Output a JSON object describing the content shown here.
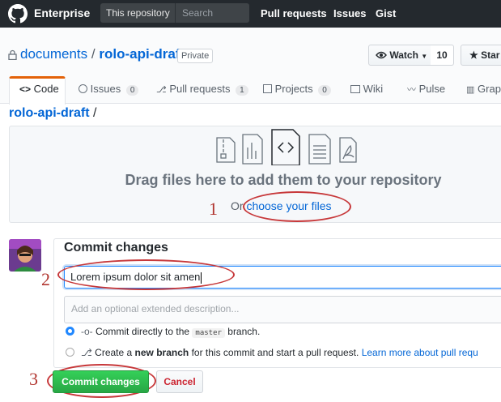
{
  "header": {
    "brand": "Enterprise",
    "scope_label": "This repository",
    "search_placeholder": "Search",
    "nav": [
      "Pull requests",
      "Issues",
      "Gist"
    ]
  },
  "repo": {
    "owner": "documents",
    "separator": "/",
    "name": "rolo-api-draft",
    "visibility": "Private",
    "watch_label": "Watch",
    "watch_count": "10",
    "star_label": "Star"
  },
  "tabs": [
    {
      "label": "Code",
      "count": null,
      "selected": true
    },
    {
      "label": "Issues",
      "count": "0"
    },
    {
      "label": "Pull requests",
      "count": "1"
    },
    {
      "label": "Projects",
      "count": "0"
    },
    {
      "label": "Wiki",
      "count": null
    },
    {
      "label": "Pulse",
      "count": null
    },
    {
      "label": "Grap",
      "count": null
    }
  ],
  "breadcrumb": {
    "repo": "rolo-api-draft",
    "slash": "/"
  },
  "dropzone": {
    "title": "Drag files here to add them to your repository",
    "or": "Or",
    "choose_link": "choose your files"
  },
  "annotations": {
    "step1": "1",
    "step2": "2",
    "step3": "3"
  },
  "commit": {
    "title": "Commit changes",
    "summary_value": "Lorem ipsum dolor sit amen",
    "description_placeholder": "Add an optional extended description...",
    "option_direct_prefix": "Commit directly to the",
    "branch": "master",
    "option_direct_suffix": "branch.",
    "option_new_prefix": "Create a",
    "option_new_bold": "new branch",
    "option_new_suffix": "for this commit and start a pull request.",
    "learn_more": "Learn more about pull requ",
    "commit_button": "Commit changes",
    "cancel_button": "Cancel"
  },
  "colors": {
    "accent": "#0366d6",
    "tab_accent": "#e36209",
    "commit_green": "#28a745",
    "annotation_red": "#c7383a"
  }
}
